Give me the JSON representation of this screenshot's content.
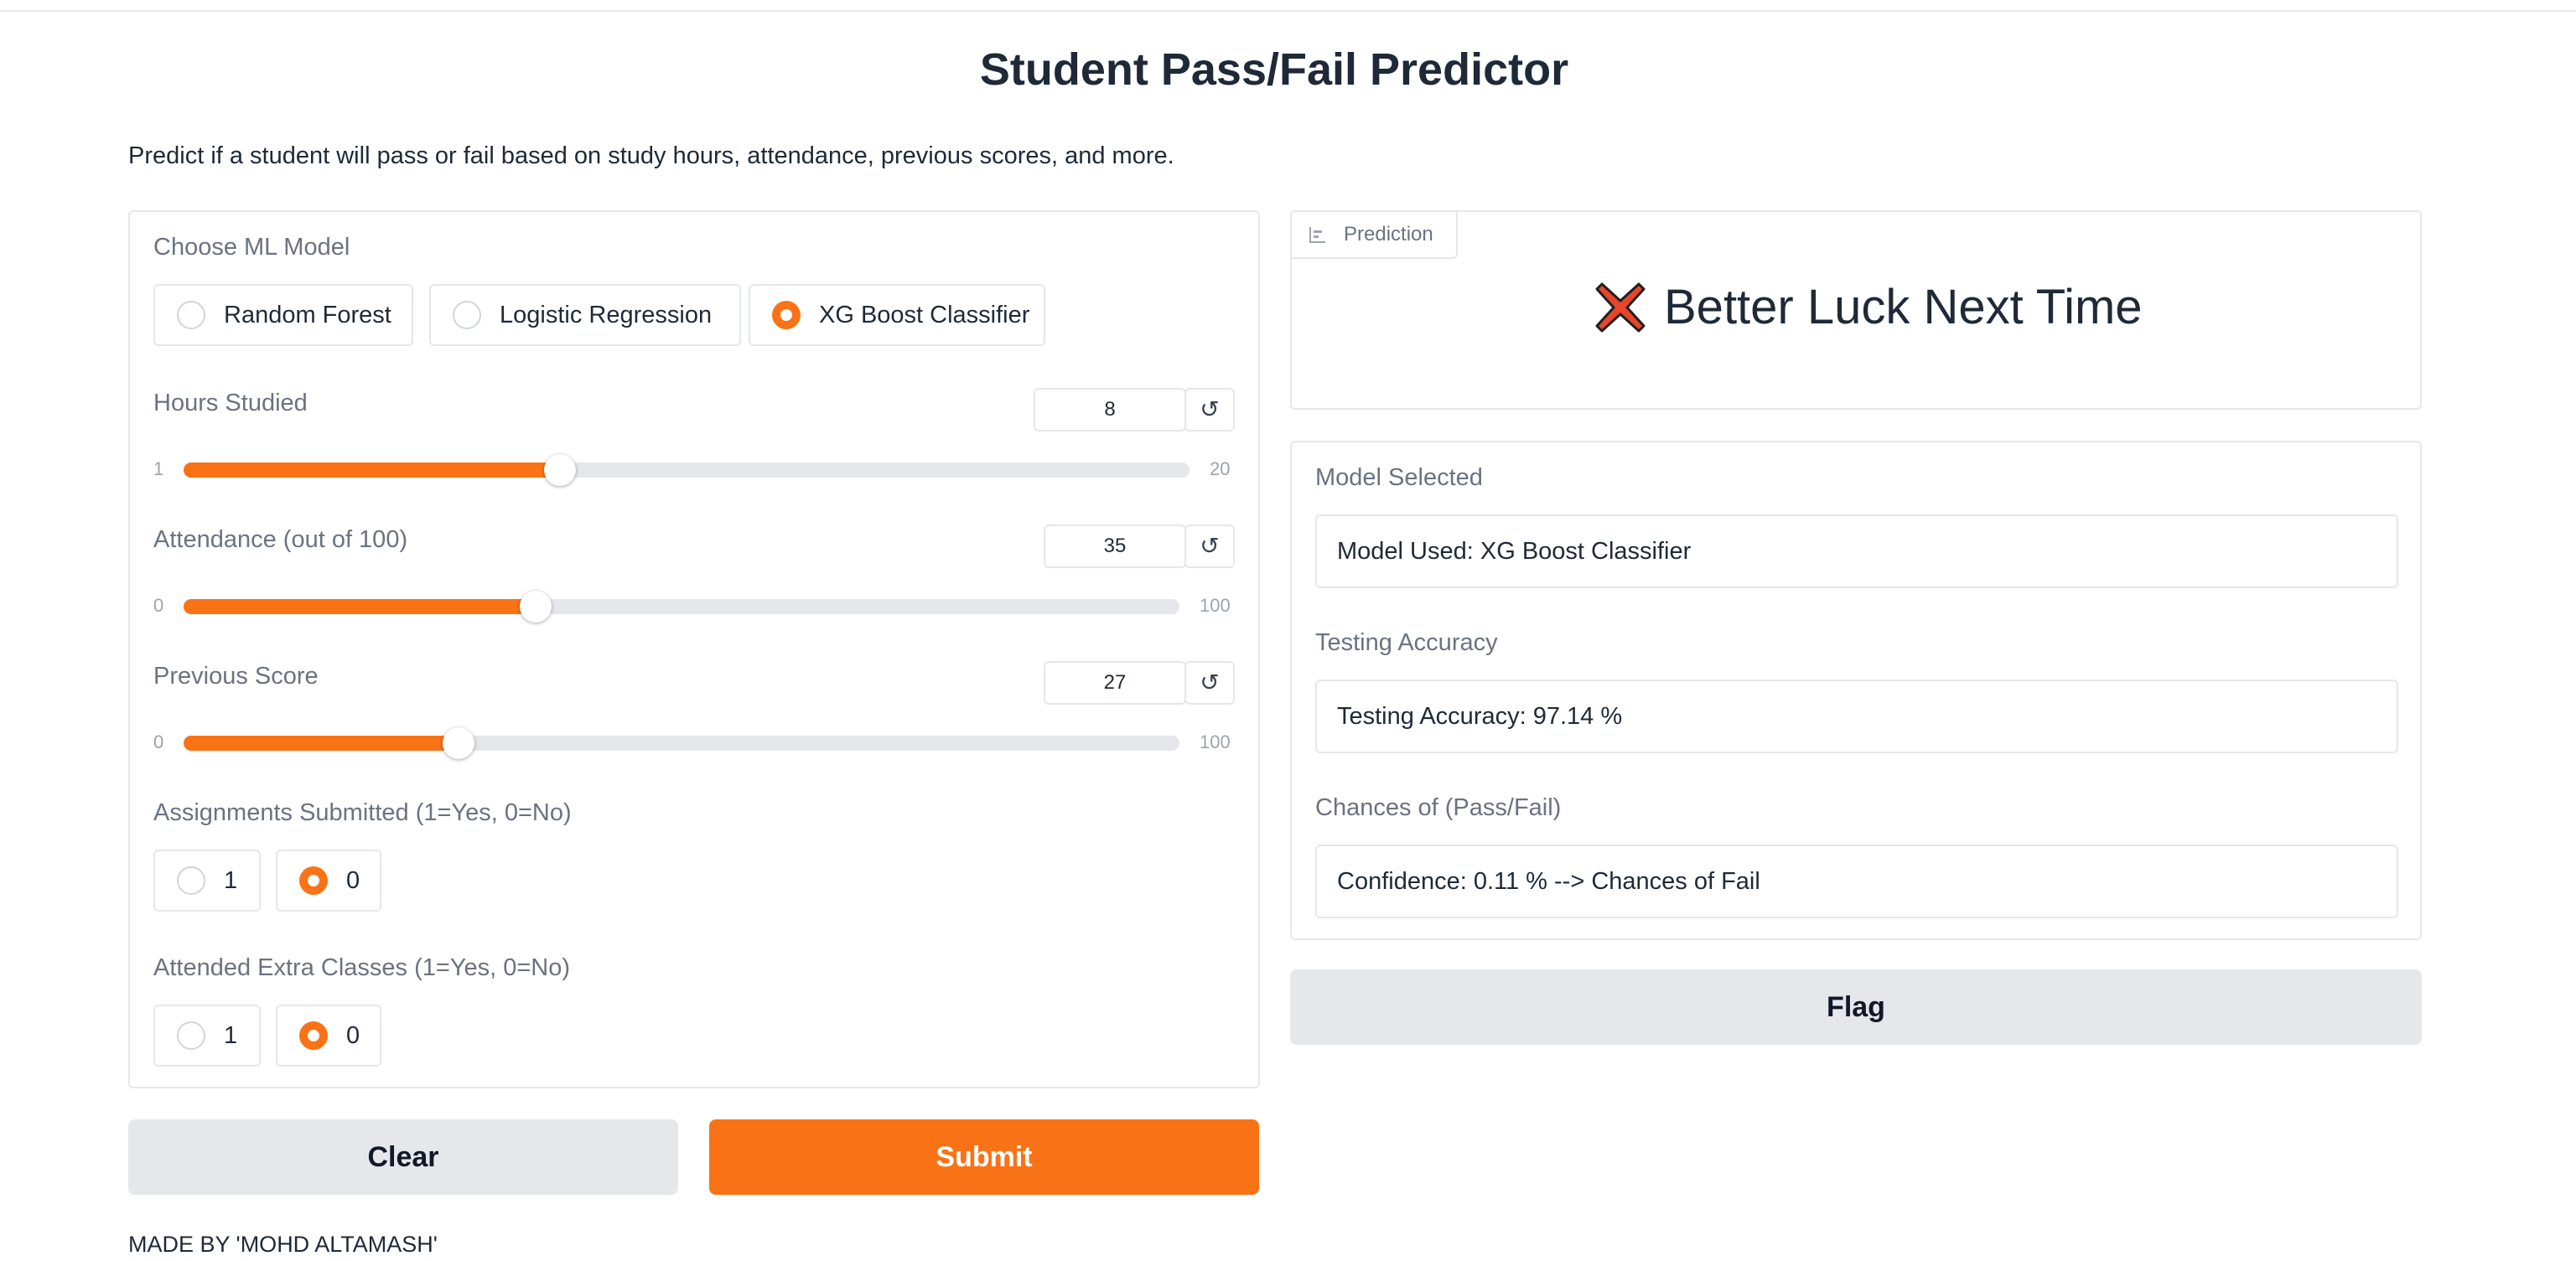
{
  "app": {
    "title": "Student Pass/Fail Predictor",
    "description": "Predict if a student will pass or fail based on study hours, attendance, previous scores, and more.",
    "footer": "MADE BY 'MOHD ALTAMASH'"
  },
  "inputs": {
    "model": {
      "label": "Choose ML Model",
      "options": [
        "Random Forest",
        "Logistic Regression",
        "XG Boost Classifier"
      ],
      "selected": "XG Boost Classifier"
    },
    "hours_studied": {
      "label": "Hours Studied",
      "value": "8",
      "min": "1",
      "max": "20",
      "reset_icon": "↺"
    },
    "attendance": {
      "label": "Attendance (out of 100)",
      "value": "35",
      "min": "0",
      "max": "100",
      "reset_icon": "↺"
    },
    "previous_score": {
      "label": "Previous Score",
      "value": "27",
      "min": "0",
      "max": "100",
      "reset_icon": "↺"
    },
    "assignments": {
      "label": "Assignments Submitted (1=Yes, 0=No)",
      "options": [
        "1",
        "0"
      ],
      "selected": "0"
    },
    "extra_classes": {
      "label": "Attended Extra Classes (1=Yes, 0=No)",
      "options": [
        "1",
        "0"
      ],
      "selected": "0"
    }
  },
  "outputs": {
    "prediction": {
      "tab_label": "Prediction",
      "text": "Better Luck Next Time",
      "icon": "cross-mark-icon"
    },
    "model_selected": {
      "label": "Model Selected",
      "value": "Model Used: XG Boost Classifier"
    },
    "testing_accuracy": {
      "label": "Testing Accuracy",
      "value": "Testing Accuracy: 97.14 %"
    },
    "chances": {
      "label": "Chances of (Pass/Fail)",
      "value": "Confidence: 0.11 % --> Chances of Fail"
    }
  },
  "buttons": {
    "clear": "Clear",
    "submit": "Submit",
    "flag": "Flag"
  },
  "colors": {
    "accent": "#f97316",
    "button_gray": "#e5e7eb",
    "border": "#e5e7eb",
    "label": "#6b7280"
  }
}
